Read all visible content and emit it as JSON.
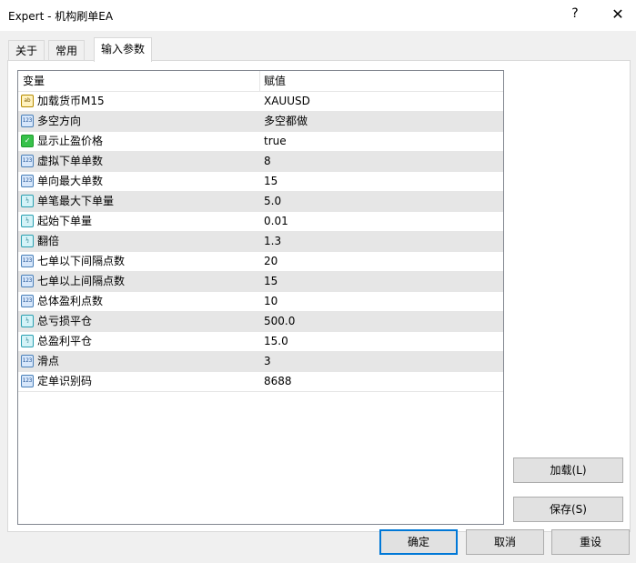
{
  "window": {
    "title": "Expert - 机构刷单EA",
    "help_label": "?",
    "close_label": "✕"
  },
  "tabs": [
    {
      "label": "关于"
    },
    {
      "label": "常用"
    },
    {
      "label": "输入参数"
    }
  ],
  "grid": {
    "header_variable": "变量",
    "header_value": "赋值",
    "rows": [
      {
        "icon": "ab",
        "name": "加载货币M15",
        "value": "XAUUSD"
      },
      {
        "icon": "123",
        "name": "多空方向",
        "value": "多空都做"
      },
      {
        "icon": "✓",
        "name": "显示止盈价格",
        "value": "true"
      },
      {
        "icon": "123",
        "name": "虚拟下单单数",
        "value": "8"
      },
      {
        "icon": "123",
        "name": "单向最大单数",
        "value": "15"
      },
      {
        "icon": "½",
        "name": "单笔最大下单量",
        "value": "5.0"
      },
      {
        "icon": "½",
        "name": "起始下单量",
        "value": "0.01"
      },
      {
        "icon": "½",
        "name": "翻倍",
        "value": "1.3"
      },
      {
        "icon": "123",
        "name": "七单以下间隔点数",
        "value": "20"
      },
      {
        "icon": "123",
        "name": "七单以上间隔点数",
        "value": "15"
      },
      {
        "icon": "123",
        "name": "总体盈利点数",
        "value": "10"
      },
      {
        "icon": "½",
        "name": "总亏损平仓",
        "value": "500.0"
      },
      {
        "icon": "½",
        "name": "总盈利平仓",
        "value": "15.0"
      },
      {
        "icon": "123",
        "name": "滑点",
        "value": "3"
      },
      {
        "icon": "123",
        "name": "定单识别码",
        "value": "8688"
      }
    ]
  },
  "buttons": {
    "load": "加载(L)",
    "save": "保存(S)",
    "ok": "确定",
    "cancel": "取消",
    "reset": "重设"
  }
}
